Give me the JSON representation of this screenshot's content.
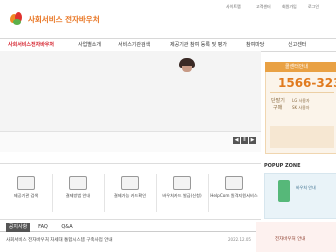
{
  "logo": {
    "text": "사회서비스 전자바우처"
  },
  "util_links": [
    "사이트맵",
    "고객센터",
    "회원가입",
    "로그인"
  ],
  "gnb": {
    "items": [
      {
        "label": "사회서비스전자바우처"
      },
      {
        "label": "사업별소개"
      },
      {
        "label": "서비스기관검색"
      },
      {
        "label": "제공기관 참여 등록 및 평가"
      },
      {
        "label": "참여마당"
      },
      {
        "label": "신고센터"
      }
    ]
  },
  "hero": {
    "prev": "◀",
    "pause": "Ⅱ",
    "next": "▶"
  },
  "side": {
    "header": "콜센터안내",
    "phone": "1566-323",
    "lines": [
      "단말기",
      "구매",
      "LG 사용자",
      "SK 사용자"
    ]
  },
  "quick": {
    "items": [
      {
        "label": "제공기관 검색"
      },
      {
        "label": "결제방법 안내"
      },
      {
        "label": "결제가능 카드확인"
      },
      {
        "label": "바우처카드 발급(신청)"
      },
      {
        "label": "HelpCom 원격지원서비스"
      }
    ]
  },
  "popup": {
    "title": "POPUP ZONE",
    "text": "바우처 안내"
  },
  "tabs": [
    {
      "label": "공지사항"
    },
    {
      "label": "FAQ"
    },
    {
      "label": "Q&A"
    }
  ],
  "notice": {
    "title": "사회서비스 전자바우처 차세대 통합시스템 구축사업 안내",
    "date": "2022.12.05"
  },
  "banner": {
    "text": "전자바우처 안내"
  },
  "colors": {
    "brand": "#e8711c",
    "accent_red": "#d5232e",
    "side_head": "#e9a144"
  }
}
